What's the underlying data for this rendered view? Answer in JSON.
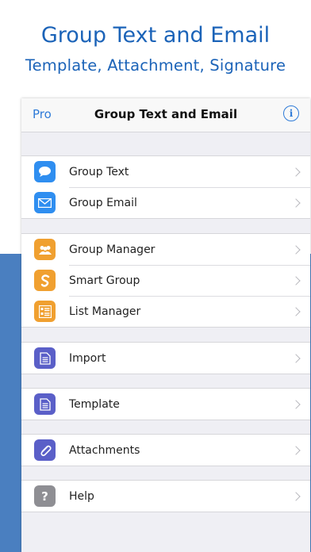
{
  "promo": {
    "headline": "Group Text and Email",
    "subheadline": "Template, Attachment, Signature"
  },
  "navbar": {
    "left_label": "Pro",
    "title": "Group Text and Email",
    "info_glyph": "i"
  },
  "menu": {
    "g1": [
      {
        "label": "Group Text",
        "icon": "message-bubble-icon",
        "color": "#2f8ef0"
      },
      {
        "label": "Group Email",
        "icon": "envelope-icon",
        "color": "#2f8ef0"
      }
    ],
    "g2": [
      {
        "label": "Group Manager",
        "icon": "people-icon",
        "color": "#f0a030"
      },
      {
        "label": "Smart Group",
        "icon": "smart-s-icon",
        "color": "#f0a030"
      },
      {
        "label": "List Manager",
        "icon": "list-icon",
        "color": "#f0a030"
      }
    ],
    "g3": [
      {
        "label": "Import",
        "icon": "document-icon",
        "color": "#5a5fc8"
      }
    ],
    "g4": [
      {
        "label": "Template",
        "icon": "document-icon",
        "color": "#5a5fc8"
      }
    ],
    "g5": [
      {
        "label": "Attachments",
        "icon": "paperclip-icon",
        "color": "#5a5fc8"
      }
    ],
    "g6": [
      {
        "label": "Help",
        "icon": "question-icon",
        "color": "#8e8e93"
      }
    ]
  }
}
